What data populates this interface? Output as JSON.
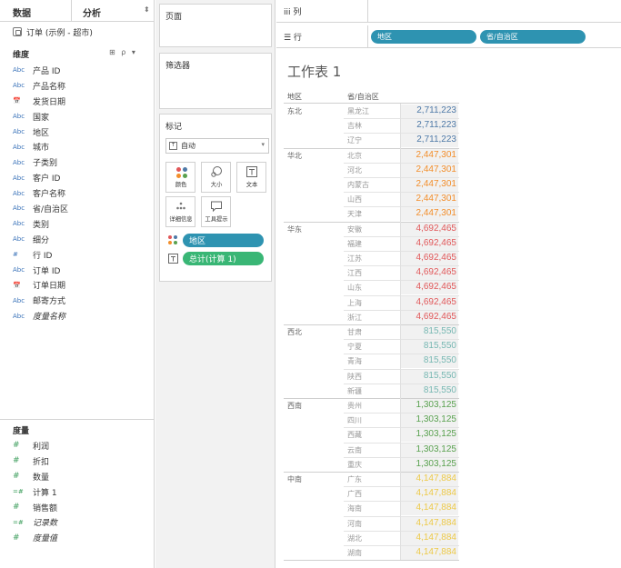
{
  "left": {
    "tab_data": "数据",
    "tab_analysis": "分析",
    "tab_caret": "⬍",
    "datasource": "订单 (示例 - 超市)",
    "dimensions_label": "维度",
    "dim_tools": "⊞ ρ ▾",
    "dimensions": [
      {
        "icon": "Abc",
        "name": "产品 ID"
      },
      {
        "icon": "Abc",
        "name": "产品名称"
      },
      {
        "icon": "📅",
        "name": "发货日期"
      },
      {
        "icon": "Abc",
        "name": "国家"
      },
      {
        "icon": "Abc",
        "name": "地区"
      },
      {
        "icon": "Abc",
        "name": "城市"
      },
      {
        "icon": "Abc",
        "name": "子类别"
      },
      {
        "icon": "Abc",
        "name": "客户 ID"
      },
      {
        "icon": "Abc",
        "name": "客户名称"
      },
      {
        "icon": "Abc",
        "name": "省/自治区"
      },
      {
        "icon": "Abc",
        "name": "类别"
      },
      {
        "icon": "Abc",
        "name": "细分"
      },
      {
        "icon": "#",
        "name": "行 ID"
      },
      {
        "icon": "Abc",
        "name": "订单 ID"
      },
      {
        "icon": "📅",
        "name": "订单日期"
      },
      {
        "icon": "Abc",
        "name": "邮寄方式"
      },
      {
        "icon": "Abc",
        "name": "度量名称"
      }
    ],
    "measures_label": "度量",
    "measures": [
      {
        "icon": "#",
        "name": "利润"
      },
      {
        "icon": "#",
        "name": "折扣"
      },
      {
        "icon": "#",
        "name": "数量"
      },
      {
        "icon": "=#",
        "name": "计算 1"
      },
      {
        "icon": "#",
        "name": "销售额"
      },
      {
        "icon": "=#",
        "name": "记录数"
      },
      {
        "icon": "#",
        "name": "度量值"
      }
    ]
  },
  "mid": {
    "pages_label": "页面",
    "filters_label": "筛选器",
    "marks_label": "标记",
    "marks_type": "自动",
    "mark_buttons": [
      "颜色",
      "大小",
      "文本",
      "详细信息",
      "工具提示"
    ],
    "pill_region": "地区",
    "pill_calc": "总计(计算 1)"
  },
  "view": {
    "columns_label": "iii 列",
    "rows_label": "☰ 行",
    "row_pill_1": "地区",
    "row_pill_2": "省/自治区",
    "sheet_title": "工作表 1",
    "hdr_region": "地区",
    "hdr_province": "省/自治区",
    "colors": {
      "东北": "#4e79a7",
      "华北": "#f28e2b",
      "华东": "#e15759",
      "西北": "#76b7b2",
      "西南": "#59a14f",
      "中南": "#edc948"
    },
    "groups": [
      {
        "region": "东北",
        "value": "2,711,223",
        "provinces": [
          "黑龙江",
          "吉林",
          "辽宁"
        ]
      },
      {
        "region": "华北",
        "value": "2,447,301",
        "provinces": [
          "北京",
          "河北",
          "内蒙古",
          "山西",
          "天津"
        ]
      },
      {
        "region": "华东",
        "value": "4,692,465",
        "provinces": [
          "安徽",
          "福建",
          "江苏",
          "江西",
          "山东",
          "上海",
          "浙江"
        ]
      },
      {
        "region": "西北",
        "value": "815,550",
        "provinces": [
          "甘肃",
          "宁夏",
          "青海",
          "陕西",
          "新疆"
        ]
      },
      {
        "region": "西南",
        "value": "1,303,125",
        "provinces": [
          "贵州",
          "四川",
          "西藏",
          "云南",
          "重庆"
        ]
      },
      {
        "region": "中南",
        "value": "4,147,884",
        "provinces": [
          "广东",
          "广西",
          "海南",
          "河南",
          "湖北",
          "湖南"
        ]
      }
    ]
  }
}
